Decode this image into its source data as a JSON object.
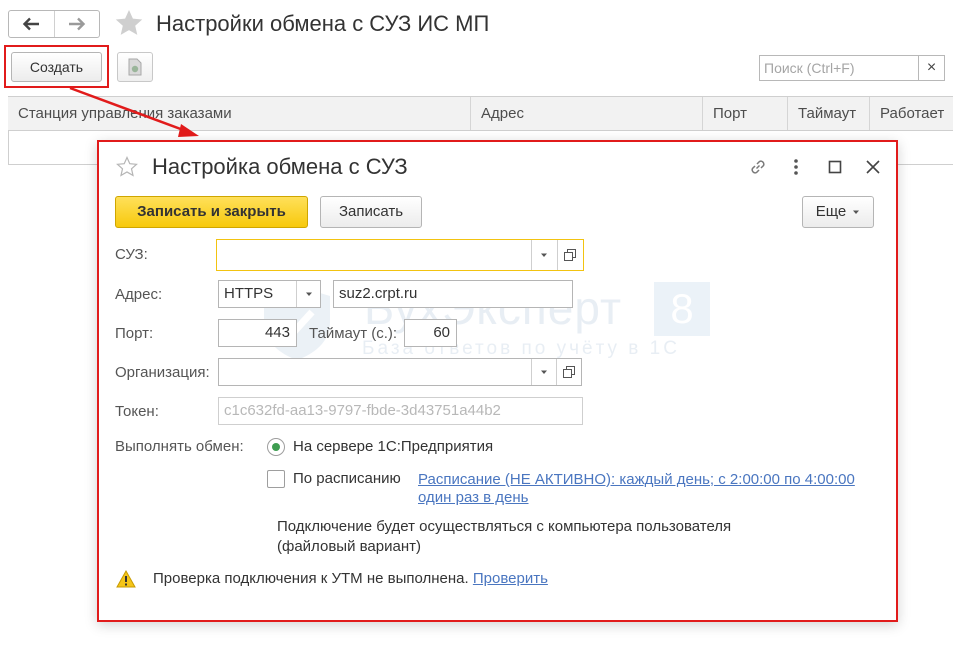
{
  "window": {
    "title": "Настройки обмена с СУЗ ИС МП",
    "nav_back_icon": "arrow-left-icon",
    "nav_forward_icon": "arrow-right-icon"
  },
  "toolbar": {
    "create_label": "Создать",
    "search_placeholder": "Поиск (Ctrl+F)",
    "clear_label": "×"
  },
  "table": {
    "columns": [
      "Станция управления заказами",
      "Адрес",
      "Порт",
      "Таймаут",
      "Работает"
    ]
  },
  "dialog": {
    "title": "Настройка обмена с СУЗ",
    "save_close_label": "Записать и закрыть",
    "save_label": "Записать",
    "more_label": "Еще",
    "fields": {
      "suz_label": "СУЗ:",
      "suz_value": "",
      "address_label": "Адрес:",
      "protocol_value": "HTTPS",
      "host_value": "suz2.crpt.ru",
      "port_label": "Порт:",
      "port_value": "443",
      "timeout_label": "Таймаут (с.):",
      "timeout_value": "60",
      "org_label": "Организация:",
      "org_value": "",
      "token_label": "Токен:",
      "token_placeholder": "c1c632fd-aa13-9797-fbde-3d43751a44b2",
      "exchange_label": "Выполнять обмен:"
    },
    "options": {
      "server_label": "На сервере 1С:Предприятия",
      "server_selected": true,
      "schedule_label": "По расписанию",
      "schedule_checked": false,
      "schedule_link_line1": "Расписание (НЕ АКТИВНО): каждый день; с 2:00:00 по 4:00:00",
      "schedule_link_line2": "один раз в день"
    },
    "note_line1": "Подключение будет осуществляться с компьютера пользователя",
    "note_line2": "(файловый вариант)",
    "warning_text": "Проверка подключения к УТМ не выполнена.",
    "check_link": "Проверить"
  },
  "watermark": {
    "brand": "БухЭксперт",
    "badge": "8",
    "subtitle": "База ответов по учёту в 1С"
  },
  "colors": {
    "primary_button": "#f7c90c",
    "highlight": "#e11b1b",
    "link": "#4a76c0",
    "radio_dot": "#3e9d51"
  }
}
